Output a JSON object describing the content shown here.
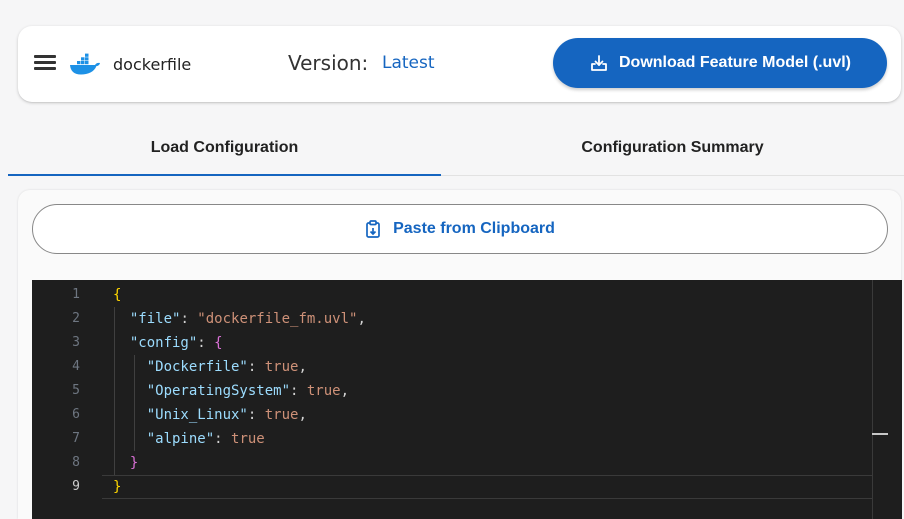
{
  "header": {
    "app_name": "dockerfile",
    "version_label": "Version:",
    "version_value": "Latest",
    "download_label": "Download Feature Model (.uvl)",
    "icons": [
      "menu-icon",
      "docker-logo-icon",
      "download-icon"
    ]
  },
  "tabs": [
    {
      "label": "Load Configuration",
      "active": true
    },
    {
      "label": "Configuration Summary",
      "active": false
    }
  ],
  "paste_button": {
    "label": "Paste from Clipboard",
    "icon": "clipboard-icon"
  },
  "editor": {
    "line_numbers": [
      "1",
      "2",
      "3",
      "4",
      "5",
      "6",
      "7",
      "8",
      "9"
    ],
    "active_line": 9,
    "tokens": {
      "l1_open": "{",
      "l2_key": "\"file\"",
      "l2_colon": ": ",
      "l2_val": "\"dockerfile_fm.uvl\"",
      "l2_comma": ",",
      "l3_key": "\"config\"",
      "l3_colon": ": ",
      "l3_open": "{",
      "l4_key": "\"Dockerfile\"",
      "l4_colon": ": ",
      "l4_val": "true",
      "l4_comma": ",",
      "l5_key": "\"OperatingSystem\"",
      "l5_colon": ": ",
      "l5_val": "true",
      "l5_comma": ",",
      "l6_key": "\"Unix_Linux\"",
      "l6_colon": ": ",
      "l6_val": "true",
      "l6_comma": ",",
      "l7_key": "\"alpine\"",
      "l7_colon": ": ",
      "l7_val": "true",
      "l8_close": "}",
      "l9_close": "}"
    }
  },
  "colors": {
    "accent": "#1565c0",
    "editor_bg": "#1e1e1e",
    "key": "#9cdcfe",
    "string": "#ce9178",
    "bracket_outer": "#ffd700",
    "bracket_inner": "#da70d6"
  }
}
